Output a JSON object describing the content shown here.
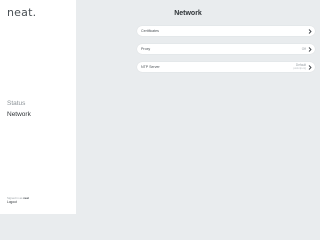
{
  "sidebar": {
    "logo": "neat.",
    "nav": [
      {
        "label": "Status",
        "active": false
      },
      {
        "label": "Network",
        "active": true
      }
    ],
    "signed_prefix": "Signed in as",
    "signed_user": "neat",
    "logout_label": "Logout"
  },
  "main": {
    "title": "Network",
    "rows": [
      {
        "label": "Certificates",
        "value": "",
        "sub": ""
      },
      {
        "label": "Proxy",
        "value": "Off",
        "sub": ""
      },
      {
        "label": "NTP Server",
        "value": "Default",
        "sub": "pool.ntp.org"
      }
    ]
  }
}
